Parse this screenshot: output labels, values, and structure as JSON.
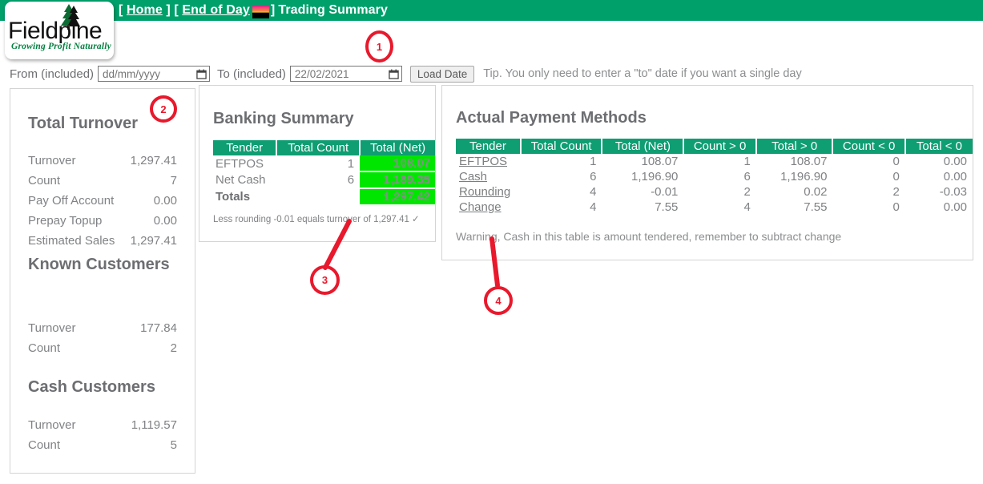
{
  "nav": {
    "open_bracket": "[",
    "home_label": "Home",
    "close_bracket": "]",
    "eod_label": "End of Day",
    "eod_icon": "sunset-icon",
    "current_page": "Trading Summary"
  },
  "logo": {
    "wordmark": "Fieldpine",
    "tagline": "Growing Profit Naturally",
    "icon": "pine-tree-icon"
  },
  "filter": {
    "from_label": "From (included)",
    "from_value": "",
    "from_placeholder": "dd/mm/yyyy",
    "to_label": "To (included)",
    "to_value": "22/02/2021",
    "to_placeholder": "dd/mm/yyyy",
    "load_button": "Load Date",
    "tip": "Tip. You only need to enter a \"to\" date if you want a single day",
    "calendar_icon": "calendar-icon"
  },
  "left_panel": {
    "sections": [
      {
        "title": "Total Turnover",
        "rows": [
          {
            "key": "Turnover",
            "value": "1,297.41"
          },
          {
            "key": "Count",
            "value": "7"
          },
          {
            "key": "Pay Off Account",
            "value": "0.00"
          },
          {
            "key": "Prepay Topup",
            "value": "0.00"
          },
          {
            "key": "Estimated Sales",
            "value": "1,297.41"
          }
        ]
      },
      {
        "title": "Known Customers",
        "rows": [
          {
            "key": "Turnover",
            "value": "177.84"
          },
          {
            "key": "Count",
            "value": "2"
          }
        ]
      },
      {
        "title": "Cash Customers",
        "rows": [
          {
            "key": "Turnover",
            "value": "1,119.57"
          },
          {
            "key": "Count",
            "value": "5"
          }
        ]
      }
    ]
  },
  "banking": {
    "title": "Banking Summary",
    "headers": [
      "Tender",
      "Total Count",
      "Total (Net)"
    ],
    "rows": [
      {
        "tender": "EFTPOS",
        "count": "1",
        "net": "108.07",
        "total": false
      },
      {
        "tender": "Net Cash",
        "count": "6",
        "net": "1,189.35",
        "total": false
      },
      {
        "tender": "Totals",
        "count": "",
        "net": "1,297.42",
        "total": true
      }
    ],
    "note": "Less rounding -0.01 equals turnover of 1,297.41 ✓"
  },
  "payments": {
    "title": "Actual Payment Methods",
    "headers": [
      "Tender",
      "Total Count",
      "Total (Net)",
      "Count > 0",
      "Total > 0",
      "Count < 0",
      "Total < 0"
    ],
    "rows": [
      {
        "tender": "EFTPOS",
        "total_count": "1",
        "total_net": "108.07",
        "count_gt": "1",
        "total_gt": "108.07",
        "count_lt": "0",
        "total_lt": "0.00"
      },
      {
        "tender": "Cash",
        "total_count": "6",
        "total_net": "1,196.90",
        "count_gt": "6",
        "total_gt": "1,196.90",
        "count_lt": "0",
        "total_lt": "0.00"
      },
      {
        "tender": "Rounding",
        "total_count": "4",
        "total_net": "-0.01",
        "count_gt": "2",
        "total_gt": "0.02",
        "count_lt": "2",
        "total_lt": "-0.03"
      },
      {
        "tender": "Change",
        "total_count": "4",
        "total_net": "7.55",
        "count_gt": "4",
        "total_gt": "7.55",
        "count_lt": "0",
        "total_lt": "0.00"
      }
    ],
    "warning": "Warning, Cash in this table is amount tendered, remember to subtract change"
  },
  "markers": [
    {
      "label": "1"
    },
    {
      "label": "2"
    },
    {
      "label": "3"
    },
    {
      "label": "4"
    }
  ],
  "colors": {
    "nav_green": "#00a06b",
    "header_green": "#0f9d72",
    "highlight_green": "#00e600",
    "marker_red": "#e8192c",
    "text_gray": "#808285"
  }
}
